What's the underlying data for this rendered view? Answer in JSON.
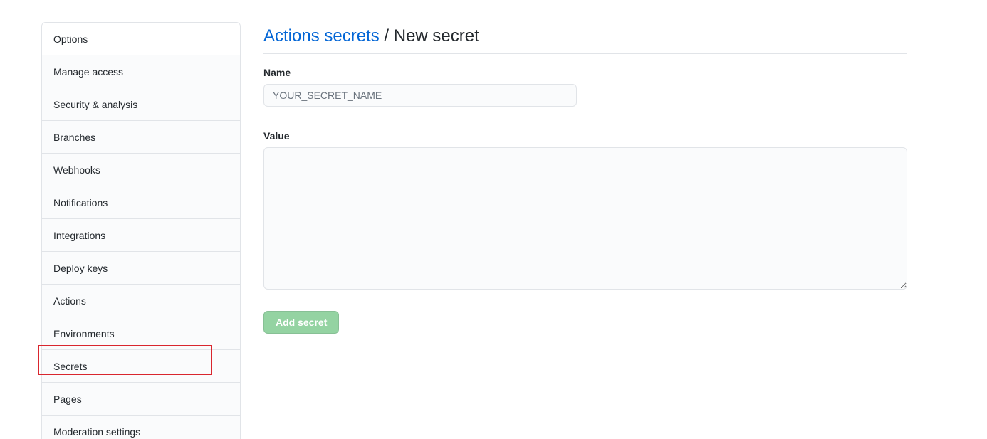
{
  "sidebar": {
    "items": [
      {
        "label": "Options"
      },
      {
        "label": "Manage access"
      },
      {
        "label": "Security & analysis"
      },
      {
        "label": "Branches"
      },
      {
        "label": "Webhooks"
      },
      {
        "label": "Notifications"
      },
      {
        "label": "Integrations"
      },
      {
        "label": "Deploy keys"
      },
      {
        "label": "Actions"
      },
      {
        "label": "Environments"
      },
      {
        "label": "Secrets"
      },
      {
        "label": "Pages"
      },
      {
        "label": "Moderation settings"
      }
    ]
  },
  "header": {
    "link": "Actions secrets",
    "separator": "/",
    "current": "New secret"
  },
  "form": {
    "name_label": "Name",
    "name_placeholder": "YOUR_SECRET_NAME",
    "name_value": "",
    "value_label": "Value",
    "value_value": "",
    "submit_label": "Add secret",
    "submit_disabled": true
  },
  "colors": {
    "link": "#0366d6",
    "button_disabled_bg": "#94d3a2",
    "highlight": "#d9262e"
  }
}
